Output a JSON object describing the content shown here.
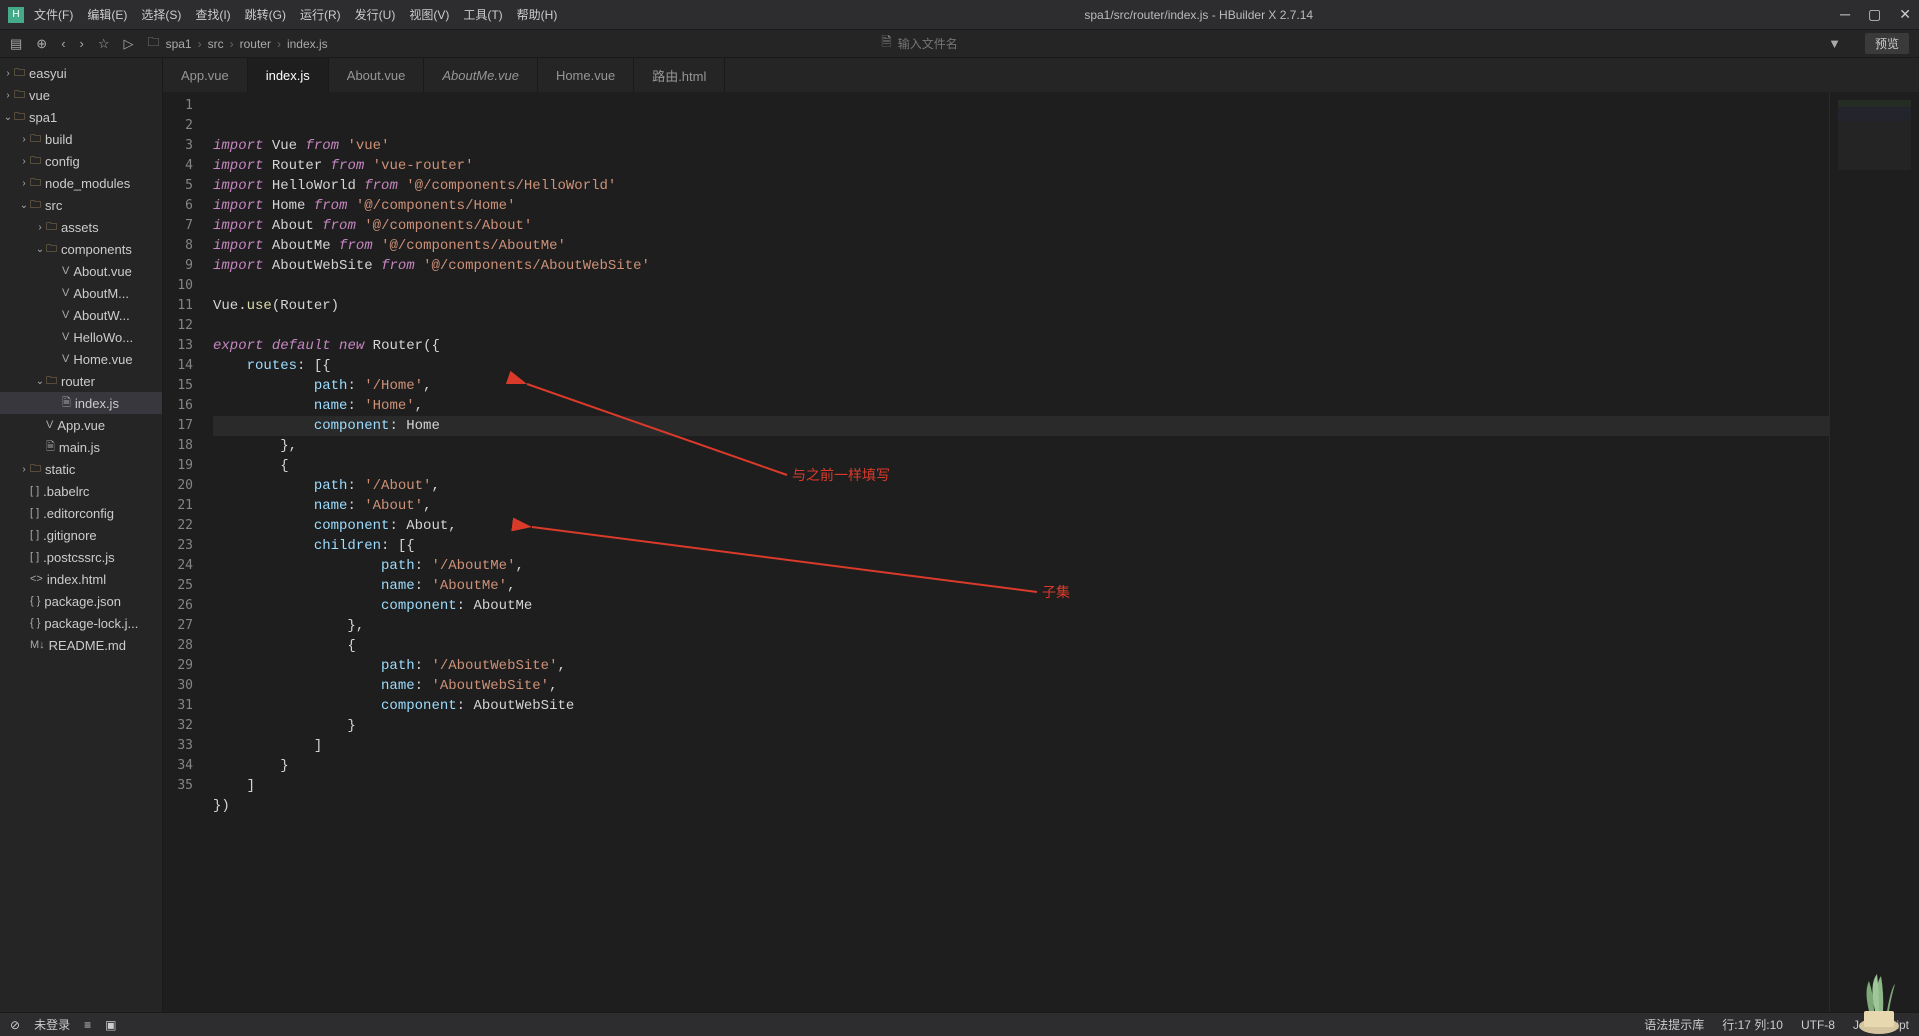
{
  "window": {
    "title": "spa1/src/router/index.js - HBuilder X 2.7.14"
  },
  "menu": {
    "file": "文件(F)",
    "edit": "编辑(E)",
    "select": "选择(S)",
    "find": "查找(I)",
    "goto": "跳转(G)",
    "run": "运行(R)",
    "publish": "发行(U)",
    "view": "视图(V)",
    "tool": "工具(T)",
    "help": "帮助(H)"
  },
  "toolbar": {
    "file_input_placeholder": "输入文件名",
    "preview": "预览"
  },
  "breadcrumb": {
    "p0": "spa1",
    "p1": "src",
    "p2": "router",
    "p3": "index.js"
  },
  "tree": {
    "easyui": "easyui",
    "vue": "vue",
    "spa1": "spa1",
    "build": "build",
    "config": "config",
    "node_modules": "node_modules",
    "src": "src",
    "assets": "assets",
    "components": "components",
    "aboutvue": "About.vue",
    "aboutm": "AboutM...",
    "aboutw": "AboutW...",
    "hellowo": "HelloWo...",
    "homevue": "Home.vue",
    "router": "router",
    "indexjs": "index.js",
    "appvue": "App.vue",
    "mainjs": "main.js",
    "static": "static",
    "babelrc": ".babelrc",
    "editorconfig": ".editorconfig",
    "gitignore": ".gitignore",
    "postcssrc": ".postcssrc.js",
    "indexhtml": "index.html",
    "packagejson": "package.json",
    "packagelock": "package-lock.j...",
    "readme": "README.md"
  },
  "tabs": {
    "t0": "App.vue",
    "t1": "index.js",
    "t2": "About.vue",
    "t3": "AboutMe.vue",
    "t4": "Home.vue",
    "t5": "路由.html"
  },
  "code": {
    "l1_a": "import",
    "l1_b": "Vue",
    "l1_c": "from",
    "l1_d": "'vue'",
    "l2_a": "import",
    "l2_b": "Router",
    "l2_c": "from",
    "l2_d": "'vue-router'",
    "l3_a": "import",
    "l3_b": "HelloWorld",
    "l3_c": "from",
    "l3_d": "'@/components/HelloWorld'",
    "l4_a": "import",
    "l4_b": "Home",
    "l4_c": "from",
    "l4_d": "'@/components/Home'",
    "l5_a": "import",
    "l5_b": "About",
    "l5_c": "from",
    "l5_d": "'@/components/About'",
    "l6_a": "import",
    "l6_b": "AboutMe",
    "l6_c": "from",
    "l6_d": "'@/components/AboutMe'",
    "l7_a": "import",
    "l7_b": "AboutWebSite",
    "l7_c": "from",
    "l7_d": "'@/components/AboutWebSite'",
    "l9_a": "Vue",
    "l9_b": ".",
    "l9_c": "use",
    "l9_d": "(Router)",
    "l11_a": "export",
    "l11_b": "default",
    "l11_c": "new",
    "l11_d": "Router",
    "l11_e": "({",
    "l12_a": "routes",
    "l12_b": ": [{",
    "l13_a": "path",
    "l13_b": ": ",
    "l13_c": "'/Home'",
    "l13_d": ",",
    "l14_a": "name",
    "l14_b": ": ",
    "l14_c": "'Home'",
    "l14_d": ",",
    "l15_a": "component",
    "l15_b": ": Home",
    "l16_a": "},",
    "l17_a": "{",
    "l18_a": "path",
    "l18_b": ": ",
    "l18_c": "'/About'",
    "l18_d": ",",
    "l19_a": "name",
    "l19_b": ": ",
    "l19_c": "'About'",
    "l19_d": ",",
    "l20_a": "component",
    "l20_b": ": About,",
    "l21_a": "children",
    "l21_b": ": [{",
    "l22_a": "path",
    "l22_b": ": ",
    "l22_c": "'/AboutMe'",
    "l22_d": ",",
    "l23_a": "name",
    "l23_b": ": ",
    "l23_c": "'AboutMe'",
    "l23_d": ",",
    "l24_a": "component",
    "l24_b": ": AboutMe",
    "l25_a": "},",
    "l26_a": "{",
    "l27_a": "path",
    "l27_b": ": ",
    "l27_c": "'/AboutWebSite'",
    "l27_d": ",",
    "l28_a": "name",
    "l28_b": ": ",
    "l28_c": "'AboutWebSite'",
    "l28_d": ",",
    "l29_a": "component",
    "l29_b": ": AboutWebSite",
    "l30_a": "}",
    "l31_a": "]",
    "l32_a": "}",
    "l33_a": "]",
    "l34_a": "})"
  },
  "annotations": {
    "a1": "与之前一样填写",
    "a2": "子集"
  },
  "status": {
    "login": "未登录",
    "syntax": "语法提示库",
    "cursor": "行:17  列:10",
    "encoding": "UTF-8",
    "language": "JavaScript"
  }
}
